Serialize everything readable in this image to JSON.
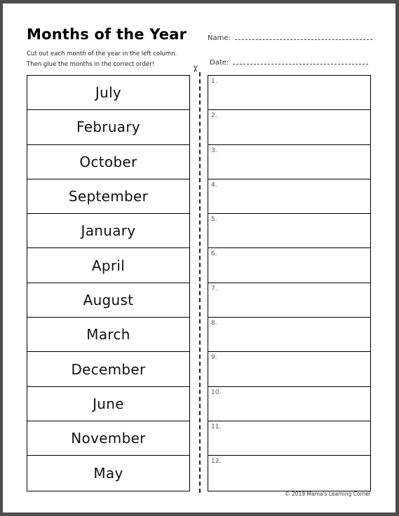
{
  "worksheet": {
    "title": "Months of the Year",
    "instructions": [
      "Cut out each month of the year in the left column.",
      "Then glue the months in the correct order!"
    ],
    "name_label": "Name:",
    "date_label": "Date:",
    "scissors_icon": "✂",
    "months": [
      "July",
      "February",
      "October",
      "September",
      "January",
      "April",
      "August",
      "March",
      "December",
      "June",
      "November",
      "May"
    ],
    "answer_numbers": [
      "1.",
      "2.",
      "3.",
      "4.",
      "5.",
      "6.",
      "7.",
      "8.",
      "9.",
      "10.",
      "11.",
      "12."
    ],
    "copyright": "© 2019  Mama's Learning Corner"
  }
}
